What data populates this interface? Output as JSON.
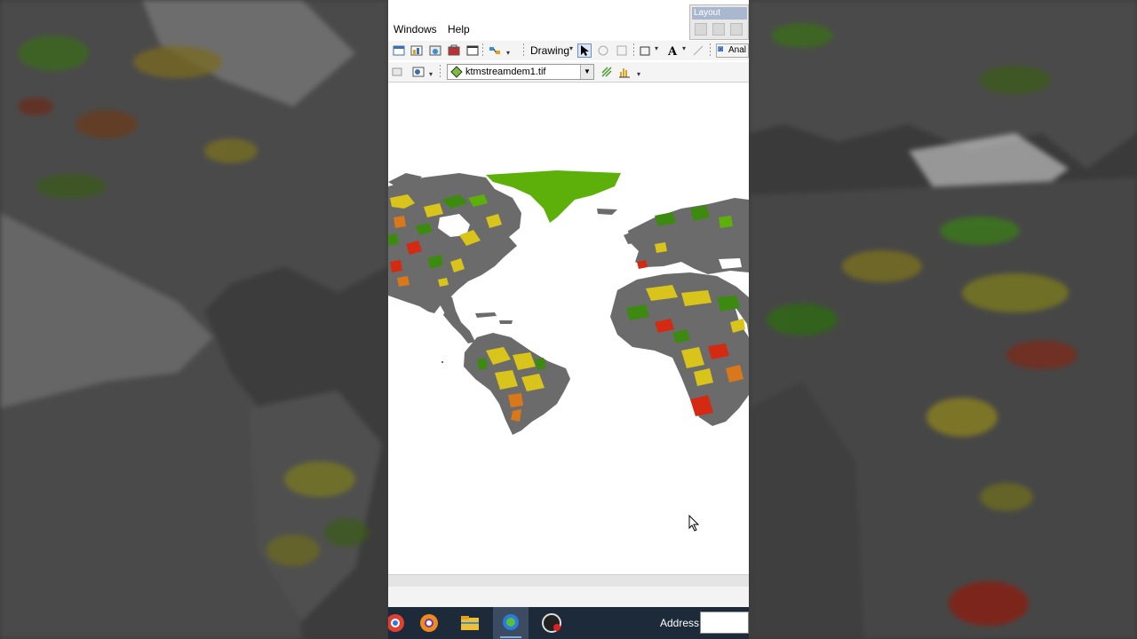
{
  "menu": {
    "windows": "Windows",
    "help": "Help"
  },
  "layout_toolbar": {
    "title": "Layout"
  },
  "drawing_toolbar": {
    "drawing_label": "Drawing",
    "analysis_label": "Anal"
  },
  "layer_select": {
    "value": "ktmstreamdem1.tif"
  },
  "taskbar": {
    "address_label": "Address",
    "address_value": ""
  },
  "icons": [
    "data-view-icon",
    "attribute-table-icon",
    "catalog-icon",
    "toolbox-icon",
    "python-window-icon",
    "model-builder-icon",
    "select-elements-icon",
    "text-icon",
    "rectangle-icon",
    "identify-icon",
    "histogram-icon"
  ],
  "map_colors": {
    "greenland": "#5db00a",
    "land_gray": "#6b6b6b",
    "green": "#3d8a10",
    "yellow": "#d8c41a",
    "orange": "#d8781a",
    "red": "#d52a12"
  }
}
